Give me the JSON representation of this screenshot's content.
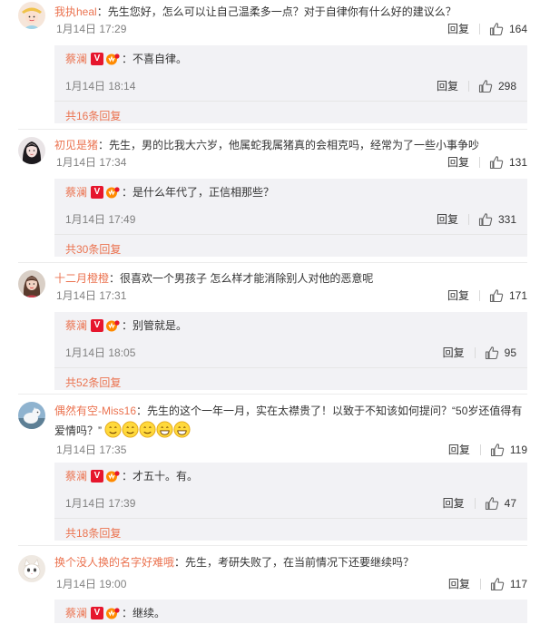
{
  "comments": [
    {
      "username": "我执heal",
      "text": "：先生您好，怎么可以让自己温柔多一点？对于自律你有什么好的建议么？",
      "text2": "",
      "time": "1月14日 17:29",
      "reply_label": "回复",
      "likes": "164",
      "reply": {
        "name": "蔡澜",
        "v_badge": "V",
        "text": "不喜自律。",
        "time": "1月14日 18:14",
        "reply_label": "回复",
        "likes": "298",
        "more": "共16条回复"
      }
    },
    {
      "username": "初见是猪",
      "text": "：先生，男的比我大六岁，他属蛇我属猪真的会相克吗，经常为了一些小事争吵",
      "text2": "",
      "time": "1月14日 17:34",
      "reply_label": "回复",
      "likes": "131",
      "reply": {
        "name": "蔡澜",
        "v_badge": "V",
        "text": "是什么年代了，正信相那些？",
        "time": "1月14日 17:49",
        "reply_label": "回复",
        "likes": "331",
        "more": "共30条回复"
      }
    },
    {
      "username": "十二月橙橙",
      "text": "：很喜欢一个男孩子 怎么样才能消除别人对他的恶意呢",
      "text2": "",
      "time": "1月14日 17:31",
      "reply_label": "回复",
      "likes": "171",
      "reply": {
        "name": "蔡澜",
        "v_badge": "V",
        "text": "别管就是。",
        "time": "1月14日 18:05",
        "reply_label": "回复",
        "likes": "95",
        "more": "共52条回复"
      }
    },
    {
      "username": "偶然有空-Miss16",
      "text": "：先生的这个一年一月，实在太襟贵了！以致于不知该如何提问？“50岁还值得有",
      "text2": "爱情吗？”",
      "time": "1月14日 17:35",
      "reply_label": "回复",
      "likes": "119",
      "reply": {
        "name": "蔡澜",
        "v_badge": "V",
        "text": "才五十。有。",
        "time": "1月14日 17:39",
        "reply_label": "回复",
        "likes": "47",
        "more": "共18条回复"
      }
    },
    {
      "username": "换个没人换的名字好难哦",
      "text": "：先生，考研失败了，在当前情况下还要继续吗？",
      "text2": "",
      "time": "1月14日 19:00",
      "reply_label": "回复",
      "likes": "117",
      "reply": {
        "name": "蔡澜",
        "v_badge": "V",
        "text": "继续。",
        "time": "",
        "reply_label": "",
        "likes": "",
        "more": ""
      }
    }
  ],
  "colors": {
    "username": "#eb7350",
    "reply_bg": "#f2f2f5",
    "verified_badge": "#e6162d",
    "meta_gray": "#808080"
  },
  "icons": {
    "like": "thumbs-up-icon",
    "verified": "verified-v-icon",
    "member": "member-crown-icon",
    "emoji": "awkward-smile-emoji"
  }
}
